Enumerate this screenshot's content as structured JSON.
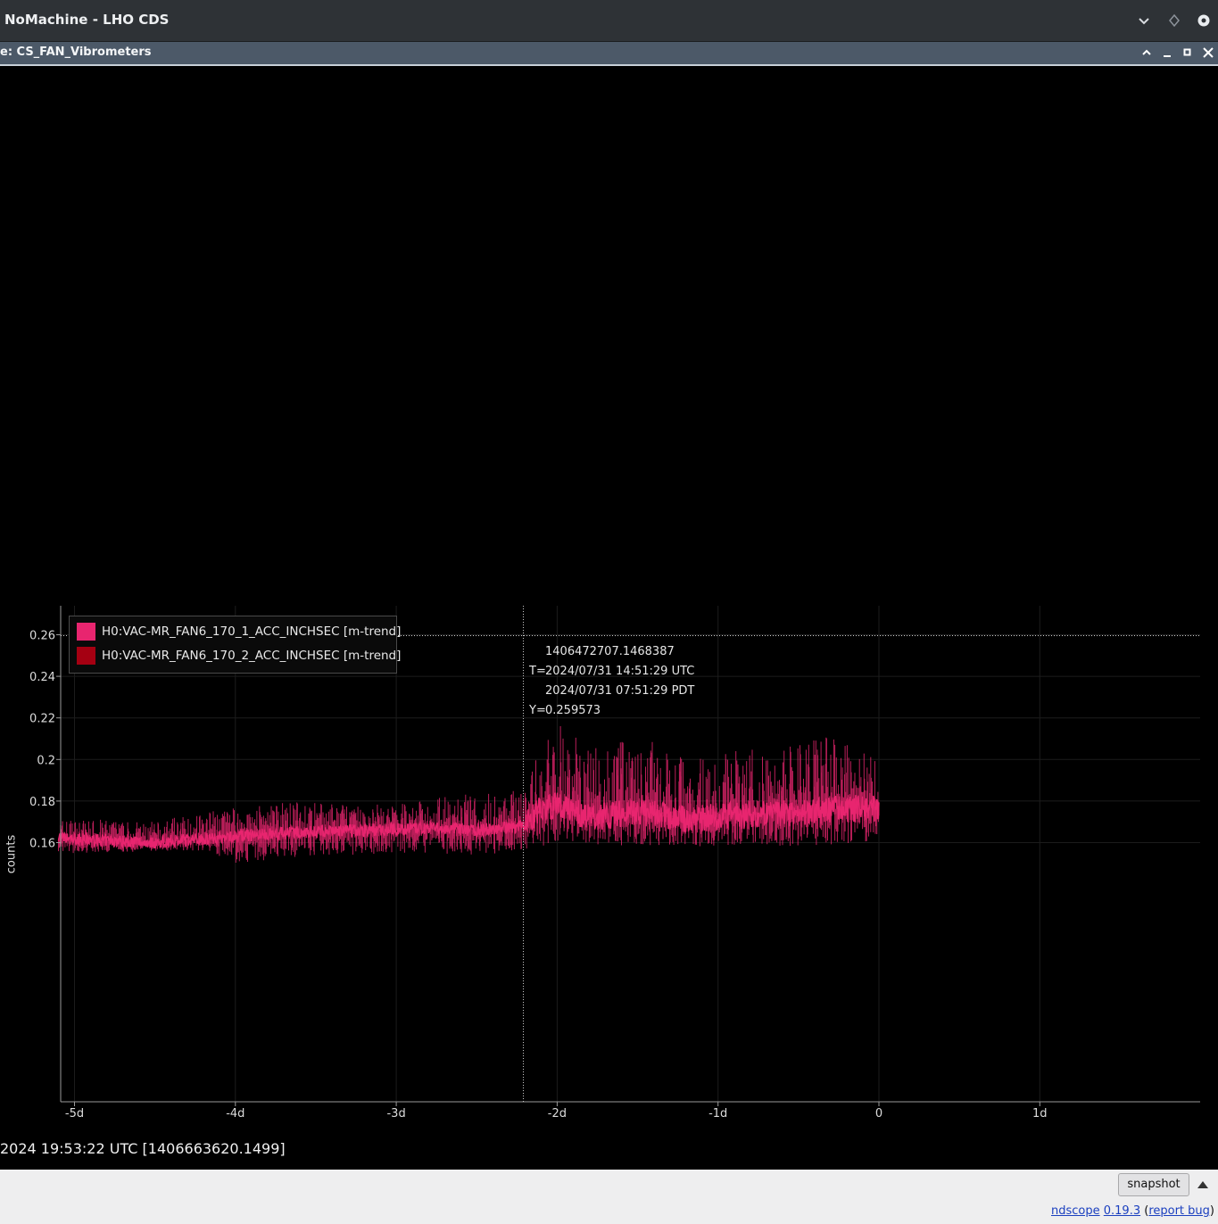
{
  "nomachine": {
    "title": "NoMachine - LHO CDS"
  },
  "window": {
    "title": "e: CS_FAN_Vibrometers"
  },
  "plot": {
    "ylabel": "counts",
    "legend": [
      {
        "label": "H0:VAC-MR_FAN6_170_1_ACC_INCHSEC [m-trend]",
        "color": "#e8256f"
      },
      {
        "label": "H0:VAC-MR_FAN6_170_2_ACC_INCHSEC [m-trend]",
        "color": "#a50012"
      }
    ],
    "cursor": {
      "gps": "1406472707.1468387",
      "t_prefix": "T=",
      "utc": "2024/07/31 14:51:29 UTC",
      "pdt": "2024/07/31 07:51:29 PDT",
      "y_prefix": "Y=",
      "y": "0.259573"
    }
  },
  "chart_data": {
    "type": "line",
    "xlabel": "",
    "ylabel": "counts",
    "x_ticks": [
      "-5d",
      "-4d",
      "-3d",
      "-2d",
      "-1d",
      "0",
      "1d"
    ],
    "y_ticks": [
      "0.16",
      "0.18",
      "0.2",
      "0.22",
      "0.24",
      "0.26"
    ],
    "xlim_days": [
      -5.1,
      2.0
    ],
    "ylim": [
      0.148,
      0.268
    ],
    "grid": true,
    "legend_position": "top-left",
    "cursor": {
      "x_days": -2.21,
      "y": 0.259573
    },
    "series": [
      {
        "name": "H0:VAC-MR_FAN6_170_1_ACC_INCHSEC [m-trend]",
        "color": "#e8256f",
        "x_days": [
          -5.1,
          -4.8,
          -4.5,
          -4.2,
          -4.0,
          -3.6,
          -3.2,
          -2.8,
          -2.5,
          -2.21,
          -2.1,
          -2.0,
          -1.8,
          -1.5,
          -1.2,
          -0.9,
          -0.6,
          -0.3,
          0.0
        ],
        "mean": [
          0.162,
          0.161,
          0.16,
          0.162,
          0.163,
          0.165,
          0.166,
          0.167,
          0.166,
          0.168,
          0.176,
          0.178,
          0.172,
          0.175,
          0.171,
          0.173,
          0.174,
          0.176,
          0.177
        ],
        "min": [
          0.155,
          0.155,
          0.156,
          0.156,
          0.15,
          0.153,
          0.154,
          0.155,
          0.154,
          0.156,
          0.158,
          0.16,
          0.158,
          0.159,
          0.158,
          0.159,
          0.158,
          0.159,
          0.16
        ],
        "max": [
          0.172,
          0.171,
          0.17,
          0.175,
          0.177,
          0.18,
          0.178,
          0.181,
          0.184,
          0.186,
          0.206,
          0.219,
          0.208,
          0.21,
          0.205,
          0.204,
          0.206,
          0.211,
          0.203
        ]
      },
      {
        "name": "H0:VAC-MR_FAN6_170_2_ACC_INCHSEC [m-trend]",
        "color": "#a50012",
        "x_days": [],
        "mean": []
      }
    ]
  },
  "status": {
    "text": "2024 19:53:22 UTC [1406663620.1499]"
  },
  "bottom": {
    "snapshot_label": "snapshot",
    "link_ndscope": "ndscope",
    "link_version": "0.19.3",
    "paren_open": "(",
    "link_report": "report bug",
    "paren_close": ")"
  }
}
